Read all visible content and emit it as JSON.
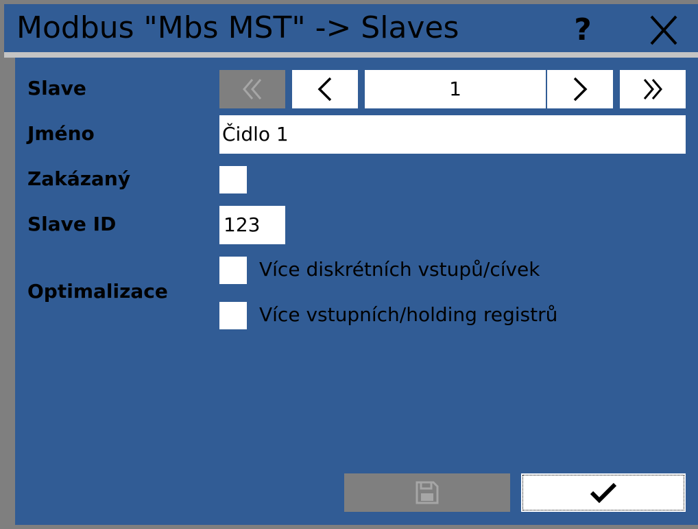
{
  "window": {
    "title": "Modbus \"Mbs MST\" -> Slaves",
    "help_label": "?",
    "close_icon": "close-icon"
  },
  "colors": {
    "title_bg": "#315c95",
    "panel_bg": "#315c95",
    "frame": "#7f7f7f",
    "disabled_button": "#7f7f7f",
    "field_bg": "#ffffff"
  },
  "form": {
    "slave_label": "Slave",
    "slave_number": "1",
    "name_label": "Jméno",
    "name_value": "Čidlo 1",
    "disabled_label": "Zakázaný",
    "disabled_checked": false,
    "slave_id_label": "Slave ID",
    "slave_id_value": "123",
    "optimization_label": "Optimalizace",
    "options": [
      {
        "label": "Více diskrétních vstupů/cívek",
        "checked": false
      },
      {
        "label": "Více vstupních/holding registrů",
        "checked": false
      }
    ]
  },
  "navigation": {
    "first_icon": "double-chevron-left-icon",
    "first_enabled": false,
    "prev_icon": "chevron-left-icon",
    "next_icon": "chevron-right-icon",
    "last_icon": "double-chevron-right-icon"
  },
  "footer": {
    "save_icon": "save-icon",
    "save_enabled": false,
    "confirm_icon": "checkmark-icon"
  }
}
